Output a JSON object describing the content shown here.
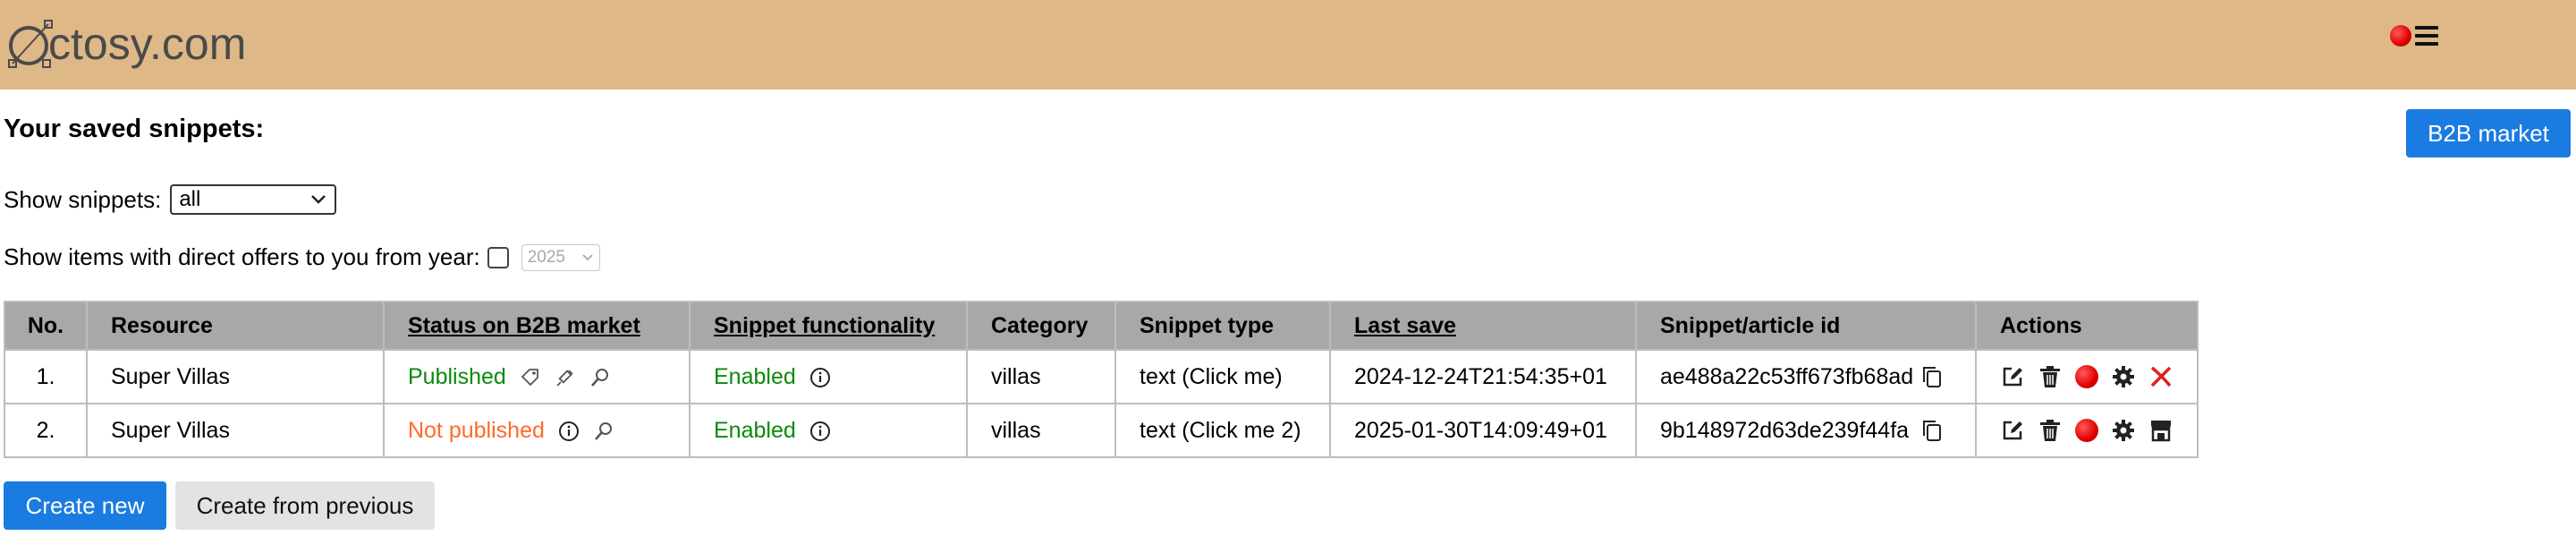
{
  "header": {
    "logo_text": "ctosy.com",
    "bg_color": "#deb887"
  },
  "page": {
    "title": "Your saved snippets:",
    "b2b_button": "B2B market"
  },
  "filters": {
    "show_label": "Show snippets:",
    "show_value": "all",
    "offers_label": "Show items with direct offers to you from year:",
    "year_value": "2025"
  },
  "table": {
    "headers": {
      "no": "No.",
      "resource": "Resource",
      "status": "Status on B2B market",
      "functionality": "Snippet functionality",
      "category": "Category",
      "type": "Snippet type",
      "last_save": "Last save",
      "id": "Snippet/article id",
      "actions": "Actions"
    },
    "rows": [
      {
        "no": "1.",
        "resource": "Super Villas",
        "status": "Published",
        "functionality": "Enabled",
        "category": "villas",
        "type": "text (Click me)",
        "last_save": "2024-12-24T21:54:35+01",
        "id": "ae488a22c53ff673fb68ad"
      },
      {
        "no": "2.",
        "resource": "Super Villas",
        "status": "Not published",
        "functionality": "Enabled",
        "category": "villas",
        "type": "text (Click me 2)",
        "last_save": "2025-01-30T14:09:49+01",
        "id": "9b148972d63de239f44fa"
      }
    ]
  },
  "buttons": {
    "create_new": "Create new",
    "create_from_previous": "Create from previous"
  },
  "colors": {
    "accent": "#1a7be0",
    "published": "#0a8a0a",
    "not_published": "#ff6a2a",
    "table_header": "#a8a8a8"
  }
}
